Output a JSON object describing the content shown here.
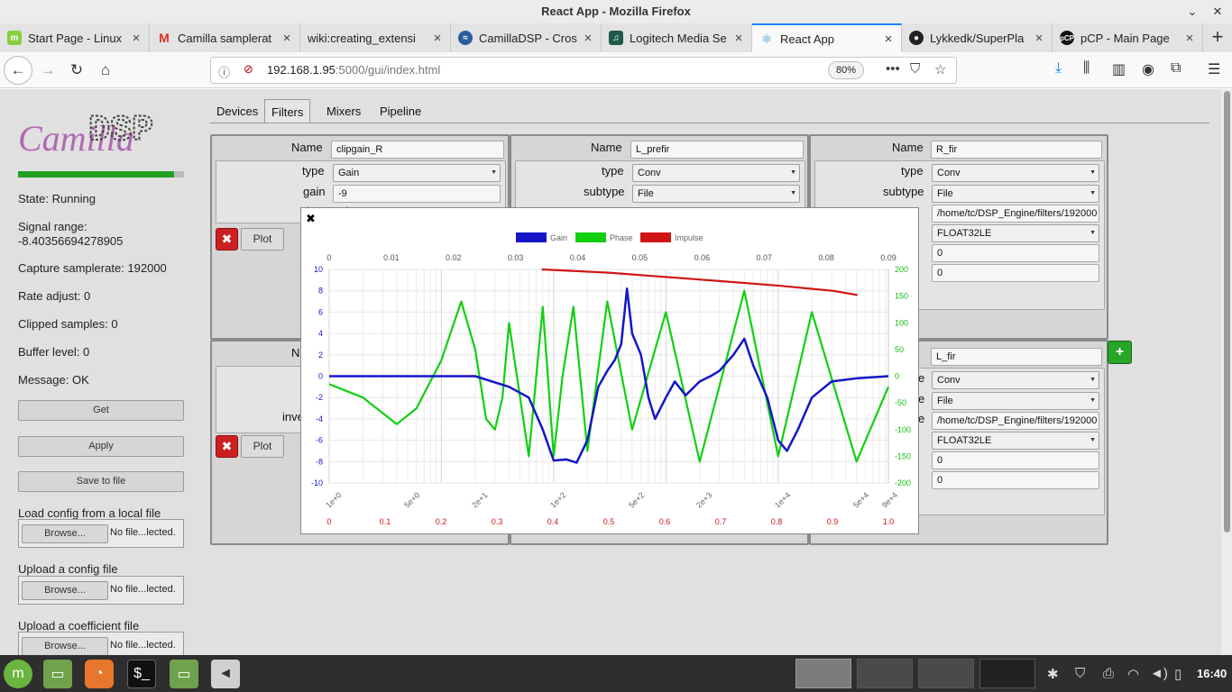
{
  "window": {
    "title": "React App - Mozilla Firefox"
  },
  "tabs": [
    {
      "title": "Start Page - Linux",
      "icon": "mint-icon"
    },
    {
      "title": "Camilla samplerat",
      "icon": "gmail-icon"
    },
    {
      "title": "wiki:creating_extensi",
      "icon": "none"
    },
    {
      "title": "CamillaDSP - Cros",
      "icon": "diyaudio-icon"
    },
    {
      "title": "Logitech Media Se",
      "icon": "lms-icon"
    },
    {
      "title": "React App",
      "icon": "react-icon"
    },
    {
      "title": "Lykkedk/SuperPla",
      "icon": "github-icon"
    },
    {
      "title": "pCP - Main Page",
      "icon": "pcp-icon"
    }
  ],
  "url": {
    "host": "192.168.1.95",
    "rest": ":5000/gui/index.html",
    "zoom": "80%"
  },
  "sidebar": {
    "logo_text": "CamillaDSP",
    "level": 0.94,
    "state": "State: Running",
    "signal_range_label": "Signal range:",
    "signal_range_value": "-8.40356694278905",
    "capture_samplerate": "Capture samplerate: 192000",
    "rate_adjust": "Rate adjust: 0",
    "clipped": "Clipped samples: 0",
    "buffer": "Buffer level: 0",
    "message": "Message: OK",
    "get": "Get",
    "apply": "Apply",
    "save": "Save to file",
    "load_local": "Load config from a local file",
    "upload_config": "Upload a config file",
    "upload_coeff": "Upload a coefficient file",
    "browse": "Browse...",
    "no_file": "No file...lected."
  },
  "nav_tabs": [
    "Devices",
    "Filters",
    "Mixers",
    "Pipeline"
  ],
  "filters": {
    "labels": {
      "name": "Name",
      "type": "type",
      "gain": "gain",
      "inverted": "inverted",
      "subtype": "subtype",
      "plot": "Plot"
    },
    "f1": {
      "name": "clipgain_R",
      "type": "Gain",
      "gain": "-9"
    },
    "f2": {
      "name": "L_prefir",
      "type": "Conv",
      "subtype": "File"
    },
    "f3": {
      "name": "R_fir",
      "type": "Conv",
      "subtype": "File",
      "path": "/home/tc/DSP_Engine/filters/192000",
      "format": "FLOAT32LE",
      "v1": "0",
      "v2": "0"
    },
    "f6": {
      "name": "L_fir",
      "type": "Conv",
      "subtype": "File",
      "path": "/home/tc/DSP_Engine/filters/192000",
      "format": "FLOAT32LE",
      "v1": "0",
      "v2": "0"
    },
    "partial": {
      "n": "N",
      "inve": "inve",
      "ive": "ive",
      "fi": "fi",
      "e": "e",
      "s": "s"
    }
  },
  "colors": {
    "gain": "#1515c8",
    "phase": "#10d010",
    "impulse": "#d01515"
  },
  "chart_data": {
    "type": "line",
    "legend": [
      "Gain",
      "Phase",
      "Impulse"
    ],
    "legend_position": "top",
    "axes": {
      "top_x": {
        "ticks": [
          "0",
          "0.01",
          "0.02",
          "0.03",
          "0.04",
          "0.05",
          "0.06",
          "0.07",
          "0.08",
          "0.09"
        ],
        "range": [
          0,
          0.09
        ]
      },
      "bottom_freq": {
        "ticks": [
          "1e+0",
          "5e+0",
          "2e+1",
          "1e+2",
          "5e+2",
          "2e+3",
          "1e+4",
          "5e+4",
          "9e+4"
        ],
        "scale": "log",
        "range": [
          1,
          96000
        ]
      },
      "bottom_red": {
        "ticks": [
          "0",
          "0.1",
          "0.2",
          "0.3",
          "0.4",
          "0.5",
          "0.6",
          "0.7",
          "0.8",
          "0.9",
          "1.0"
        ],
        "range": [
          0,
          1.0
        ]
      },
      "left_y": {
        "ticks": [
          "10",
          "8",
          "6",
          "4",
          "2",
          "0",
          "-2",
          "-4",
          "-6",
          "-8",
          "-10"
        ],
        "range": [
          -10,
          10
        ]
      },
      "right_y": {
        "ticks": [
          "200",
          "150",
          "100",
          "50",
          "0",
          "-50",
          "-100",
          "-150",
          "-200"
        ],
        "range": [
          -200,
          200
        ]
      }
    },
    "series": [
      {
        "name": "Gain",
        "axis": "left",
        "x": [
          1,
          20,
          40,
          60,
          80,
          100,
          130,
          160,
          200,
          250,
          300,
          350,
          400,
          450,
          500,
          600,
          700,
          800,
          1000,
          1200,
          1500,
          2000,
          2500,
          3000,
          4000,
          5000,
          6000,
          8000,
          10000,
          12000,
          15000,
          20000,
          30000,
          50000,
          96000
        ],
        "y": [
          0,
          0,
          -1,
          -2,
          -5,
          -7.9,
          -7.8,
          -8.1,
          -6,
          -1,
          0.5,
          1.5,
          3,
          8.2,
          4,
          2,
          -2,
          -4,
          -2,
          -0.5,
          -1.8,
          -0.5,
          0,
          0.5,
          2,
          3.5,
          1,
          -2,
          -6,
          -7,
          -5,
          -2,
          -0.5,
          -0.2,
          0
        ]
      },
      {
        "name": "Phase",
        "axis": "right",
        "x": [
          1,
          2,
          4,
          6,
          10,
          15,
          20,
          25,
          30,
          35,
          40,
          60,
          80,
          100,
          120,
          150,
          200,
          300,
          500,
          1000,
          2000,
          5000,
          10000,
          20000,
          50000,
          96000
        ],
        "y": [
          -15,
          -40,
          -90,
          -60,
          30,
          140,
          50,
          -80,
          -100,
          -40,
          100,
          -150,
          130,
          -150,
          0,
          130,
          -140,
          140,
          -100,
          120,
          -160,
          160,
          -150,
          120,
          -160,
          -20
        ]
      },
      {
        "name": "Impulse",
        "axis": "bottom_red",
        "x": [
          0.38,
          0.5,
          0.6,
          0.7,
          0.8,
          0.9,
          0.945
        ],
        "y": [
          10,
          9.7,
          9.3,
          8.9,
          8.5,
          8.0,
          7.6
        ]
      }
    ]
  },
  "taskbar": {
    "clock": "16:40"
  }
}
